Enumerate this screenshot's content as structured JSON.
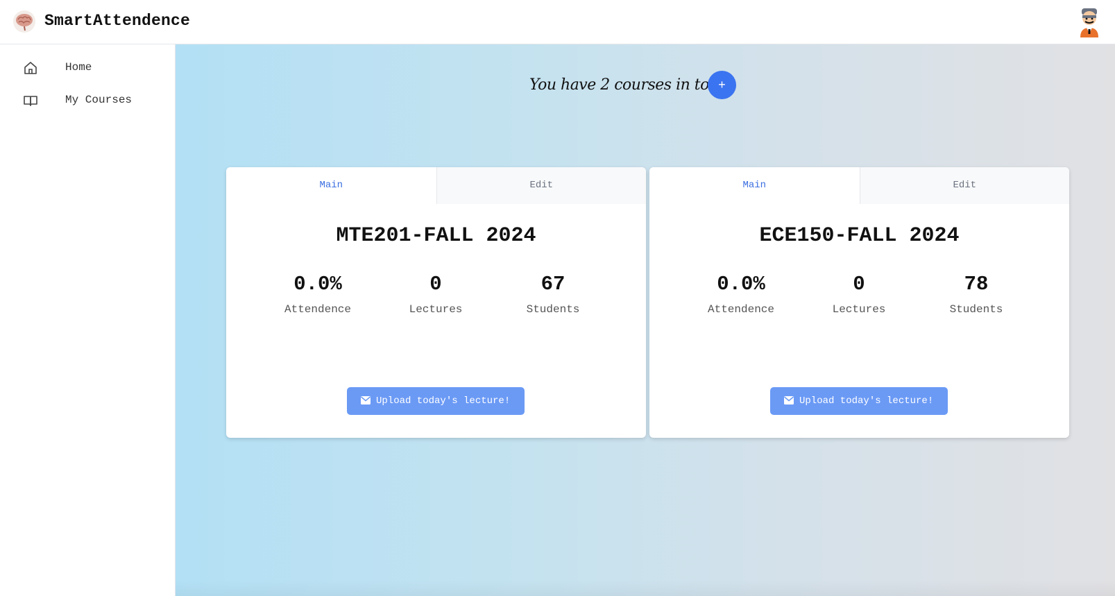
{
  "app": {
    "title": "SmartAttendence"
  },
  "sidebar": {
    "items": [
      {
        "label": "Home",
        "icon": "home-icon"
      },
      {
        "label": "My Courses",
        "icon": "book-open-icon"
      }
    ]
  },
  "header": {
    "summary": "You have 2 courses in total",
    "add_label": "+"
  },
  "courses": [
    {
      "title": "MTE201-FALL 2024",
      "tabs": {
        "main": "Main",
        "edit": "Edit"
      },
      "stats": [
        {
          "value": "0.0%",
          "label": "Attendence"
        },
        {
          "value": "0",
          "label": "Lectures"
        },
        {
          "value": "67",
          "label": "Students"
        }
      ],
      "upload_label": "Upload today's lecture!"
    },
    {
      "title": "ECE150-FALL 2024",
      "tabs": {
        "main": "Main",
        "edit": "Edit"
      },
      "stats": [
        {
          "value": "0.0%",
          "label": "Attendence"
        },
        {
          "value": "0",
          "label": "Lectures"
        },
        {
          "value": "78",
          "label": "Students"
        }
      ],
      "upload_label": "Upload today's lecture!"
    }
  ],
  "colors": {
    "accent": "#3b74f0",
    "tab_active": "#3b6fe0",
    "upload_button": "#6b9af5",
    "gradient_start": "#b3e0f5",
    "gradient_end": "#e1e1e4"
  }
}
